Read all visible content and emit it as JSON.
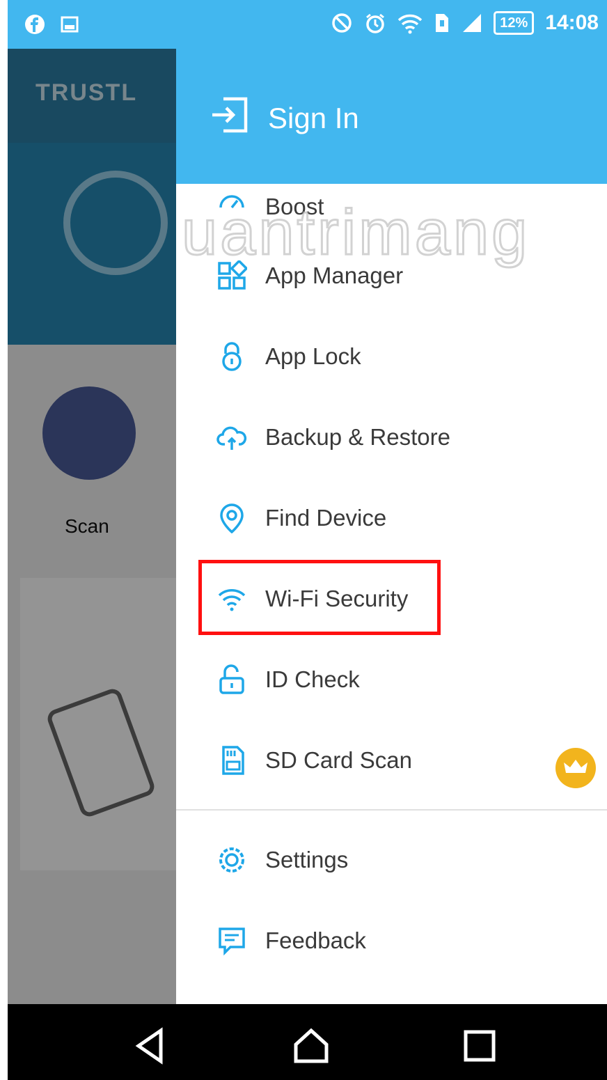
{
  "status_bar": {
    "battery": "12%",
    "time": "14:08"
  },
  "background_app": {
    "logo_text": "TRUSTL",
    "scan_label": "Scan"
  },
  "drawer": {
    "sign_in_label": "Sign In",
    "menu_items": [
      {
        "label": "Boost",
        "icon": "speedometer-icon"
      },
      {
        "label": "App Manager",
        "icon": "grid-icon"
      },
      {
        "label": "App Lock",
        "icon": "lock-icon"
      },
      {
        "label": "Backup & Restore",
        "icon": "cloud-sync-icon"
      },
      {
        "label": "Find Device",
        "icon": "location-pin-icon"
      },
      {
        "label": "Wi-Fi Security",
        "icon": "wifi-icon"
      },
      {
        "label": "ID Check",
        "icon": "open-lock-icon"
      },
      {
        "label": "SD Card Scan",
        "icon": "sd-card-icon",
        "badge": "crown-icon"
      },
      {
        "label": "Settings",
        "icon": "gear-icon"
      },
      {
        "label": "Feedback",
        "icon": "message-icon"
      }
    ]
  },
  "watermark": "uantrimang",
  "colors": {
    "accent": "#42b7ef",
    "icon": "#1ea7e8",
    "highlight": "#ff1010",
    "badge": "#f2b41d"
  }
}
